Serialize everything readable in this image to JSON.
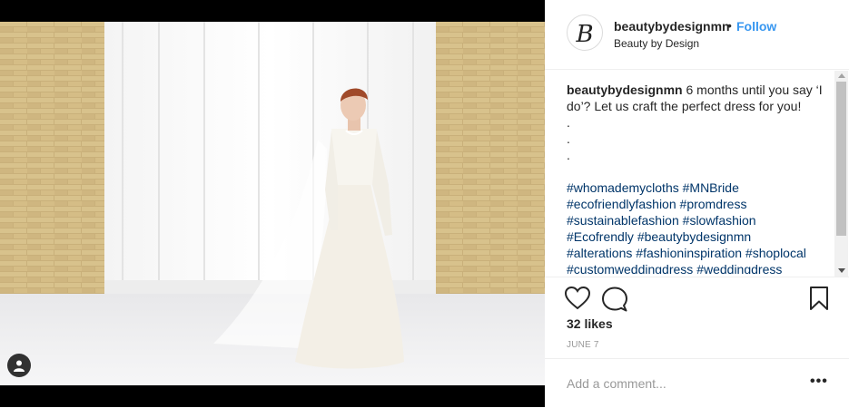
{
  "post": {
    "username": "beautybydesignmn",
    "separator": "•",
    "follow_label": "Follow",
    "location": "Beauty by Design",
    "avatar_letter": "B",
    "image_alt": "Bride in off-shoulder lace wedding gown with long veil in front of a window and brick wall"
  },
  "caption": {
    "username": "beautybydesignmn",
    "text": "6 months until you say ‘I do’? Let us craft the perfect dress for you!",
    "dots": [
      ".",
      ".",
      "."
    ],
    "hashtags": [
      "#whomademycloths",
      "#MNBride",
      "#ecofriendlyfashion",
      "#promdress",
      "#sustainablefashion",
      "#slowfashion",
      "#Ecofrendly",
      "#beautybydesignmn",
      "#alterations",
      "#fashioninspiration",
      "#shoplocal",
      "#customweddingdress",
      "#weddingdress"
    ]
  },
  "stats": {
    "likes": "32 likes",
    "date": "JUNE 7"
  },
  "comment_box": {
    "placeholder": "Add a comment...",
    "more_label": "•••"
  },
  "icons": {
    "like": "heart-icon",
    "comment": "comment-bubble-icon",
    "save": "bookmark-icon",
    "tag": "user-tag-icon"
  },
  "colors": {
    "follow": "#3897f0",
    "hashtag": "#003569",
    "text": "#262626",
    "muted": "#999999"
  }
}
